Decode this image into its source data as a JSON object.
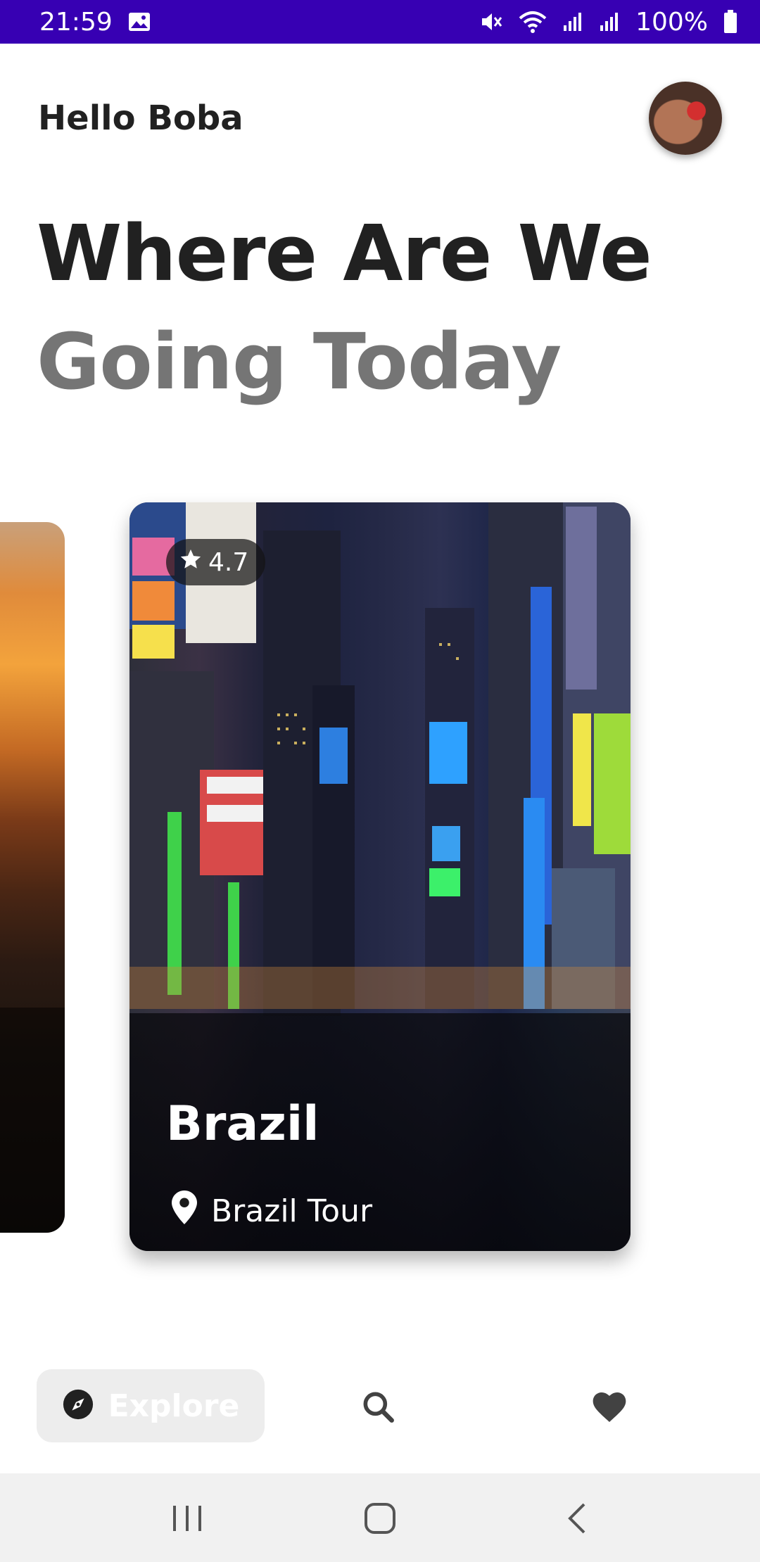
{
  "status_bar": {
    "time": "21:59",
    "battery": "100%",
    "icons": [
      "image-icon",
      "mute-icon",
      "wifi-icon",
      "signal-icon",
      "signal-icon",
      "battery-icon"
    ],
    "background": "#3700b3"
  },
  "header": {
    "greeting": "Hello Boba",
    "avatar": "user-avatar"
  },
  "headline": {
    "line1": "Where Are We",
    "line2": "Going Today",
    "line1_color": "#212121",
    "line2_color": "#757575"
  },
  "cards": [
    {
      "rating": "4.7",
      "title": "Brazil",
      "location": "Brazil Tour",
      "rating_icon": "star-icon",
      "location_icon": "location-pin-icon"
    }
  ],
  "bottom_nav": {
    "items": [
      {
        "label": "Explore",
        "icon": "compass-icon",
        "selected": true
      },
      {
        "label": "",
        "icon": "search-icon",
        "selected": false
      },
      {
        "label": "",
        "icon": "heart-icon",
        "selected": false
      }
    ]
  },
  "system_nav": {
    "buttons": [
      "recents-icon",
      "home-icon",
      "back-icon"
    ]
  }
}
